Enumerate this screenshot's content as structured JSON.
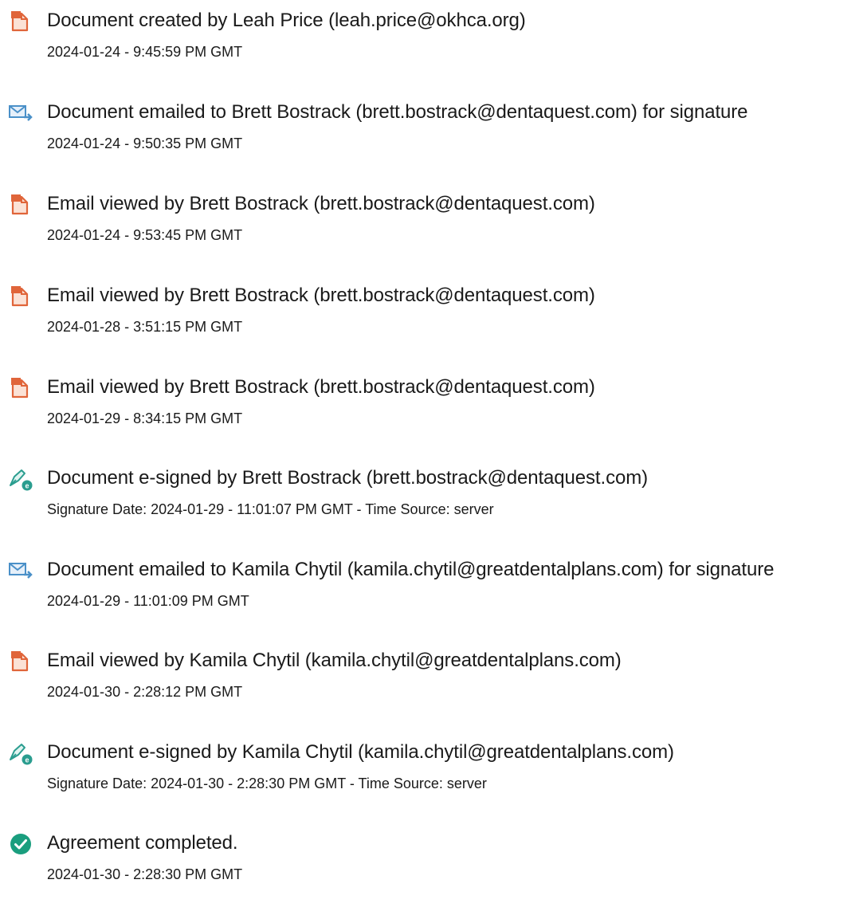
{
  "events": [
    {
      "icon": "document-created-icon",
      "title": "Document created by Leah Price (leah.price@okhca.org)",
      "detail": "2024-01-24 - 9:45:59 PM GMT"
    },
    {
      "icon": "email-sent-icon",
      "title": "Document emailed to Brett Bostrack (brett.bostrack@dentaquest.com) for signature",
      "detail": "2024-01-24 - 9:50:35 PM GMT"
    },
    {
      "icon": "document-viewed-icon",
      "title": "Email viewed by Brett Bostrack (brett.bostrack@dentaquest.com)",
      "detail": "2024-01-24 - 9:53:45 PM GMT"
    },
    {
      "icon": "document-viewed-icon",
      "title": "Email viewed by Brett Bostrack (brett.bostrack@dentaquest.com)",
      "detail": "2024-01-28 - 3:51:15 PM GMT"
    },
    {
      "icon": "document-viewed-icon",
      "title": "Email viewed by Brett Bostrack (brett.bostrack@dentaquest.com)",
      "detail": "2024-01-29 - 8:34:15 PM GMT"
    },
    {
      "icon": "e-sign-pen-icon",
      "title": "Document e-signed by Brett Bostrack (brett.bostrack@dentaquest.com)",
      "detail": "Signature Date: 2024-01-29 - 11:01:07 PM GMT - Time Source: server"
    },
    {
      "icon": "email-sent-icon",
      "title": "Document emailed to Kamila Chytil (kamila.chytil@greatdentalplans.com) for signature",
      "detail": "2024-01-29 - 11:01:09 PM GMT"
    },
    {
      "icon": "document-viewed-icon",
      "title": "Email viewed by Kamila Chytil (kamila.chytil@greatdentalplans.com)",
      "detail": "2024-01-30 - 2:28:12 PM GMT"
    },
    {
      "icon": "e-sign-pen-icon",
      "title": "Document e-signed by Kamila Chytil (kamila.chytil@greatdentalplans.com)",
      "detail": "Signature Date: 2024-01-30 - 2:28:30 PM GMT - Time Source: server"
    },
    {
      "icon": "check-circle-icon",
      "title": "Agreement completed.",
      "detail": "2024-01-30 - 2:28:30 PM GMT"
    }
  ],
  "colors": {
    "document_icon": "#e0653a",
    "email_icon": "#4a90c8",
    "sign_icon": "#2a9d8f",
    "check_icon": "#1a9e7e",
    "text": "#1a1a1a"
  }
}
